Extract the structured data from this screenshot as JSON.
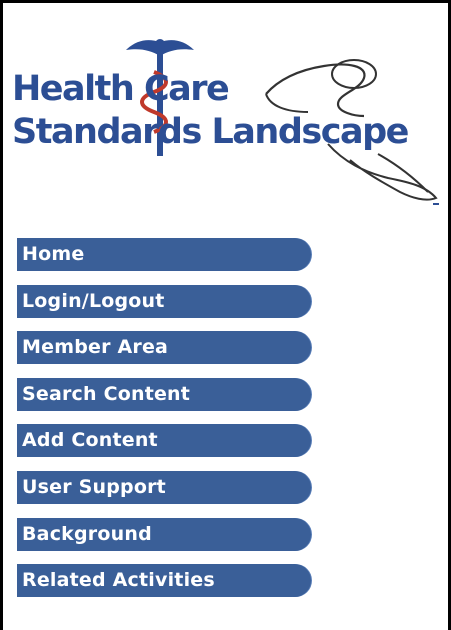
{
  "logo": {
    "line1": "Health Care",
    "line2": "Standards Landscape",
    "icon": "caduceus-stethoscope-icon"
  },
  "nav": {
    "items": [
      {
        "label": "Home"
      },
      {
        "label": "Login/Logout"
      },
      {
        "label": "Member Area"
      },
      {
        "label": "Search Content"
      },
      {
        "label": "Add Content"
      },
      {
        "label": "User Support"
      },
      {
        "label": "Background"
      },
      {
        "label": "Related Activities"
      }
    ]
  },
  "colors": {
    "brand": "#2c4e94",
    "nav_bg": "#3a5f98",
    "nav_text": "#ffffff"
  }
}
